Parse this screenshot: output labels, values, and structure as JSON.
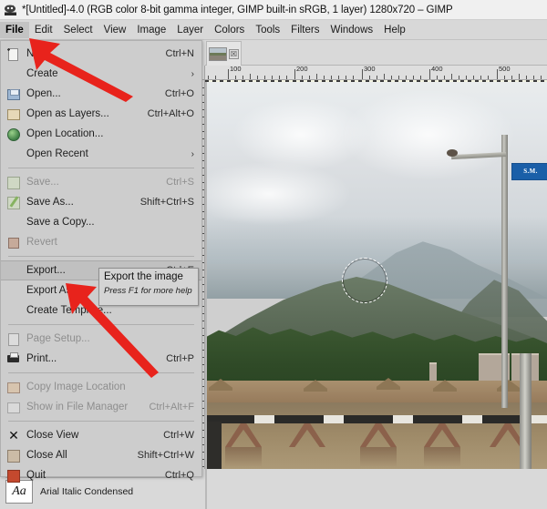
{
  "window": {
    "title": "*[Untitled]-4.0 (RGB color 8-bit gamma integer, GIMP built-in sRGB, 1 layer) 1280x720 – GIMP",
    "app_icon": "gimp-wilber-icon"
  },
  "menubar": {
    "items": [
      {
        "label": "File",
        "active": true
      },
      {
        "label": "Edit",
        "active": false
      },
      {
        "label": "Select",
        "active": false
      },
      {
        "label": "View",
        "active": false
      },
      {
        "label": "Image",
        "active": false
      },
      {
        "label": "Layer",
        "active": false
      },
      {
        "label": "Colors",
        "active": false
      },
      {
        "label": "Tools",
        "active": false
      },
      {
        "label": "Filters",
        "active": false
      },
      {
        "label": "Windows",
        "active": false
      },
      {
        "label": "Help",
        "active": false
      }
    ]
  },
  "file_menu": {
    "items": [
      {
        "label": "New...",
        "accel": "Ctrl+N",
        "icon": "new-file-icon",
        "disabled": false,
        "submenu": false,
        "selected": false
      },
      {
        "label": "Create",
        "accel": "",
        "icon": "",
        "disabled": false,
        "submenu": true,
        "selected": false
      },
      {
        "label": "Open...",
        "accel": "Ctrl+O",
        "icon": "open-file-icon",
        "disabled": false,
        "submenu": false,
        "selected": false
      },
      {
        "label": "Open as Layers...",
        "accel": "Ctrl+Alt+O",
        "icon": "open-as-layers-icon",
        "disabled": false,
        "submenu": false,
        "selected": false
      },
      {
        "label": "Open Location...",
        "accel": "",
        "icon": "globe-icon",
        "disabled": false,
        "submenu": false,
        "selected": false
      },
      {
        "label": "Open Recent",
        "accel": "",
        "icon": "",
        "disabled": false,
        "submenu": true,
        "selected": false
      },
      {
        "separator": true
      },
      {
        "label": "Save...",
        "accel": "Ctrl+S",
        "icon": "save-icon",
        "disabled": true,
        "submenu": false,
        "selected": false
      },
      {
        "label": "Save As...",
        "accel": "Shift+Ctrl+S",
        "icon": "save-as-icon",
        "disabled": false,
        "submenu": false,
        "selected": false
      },
      {
        "label": "Save a Copy...",
        "accel": "",
        "icon": "",
        "disabled": false,
        "submenu": false,
        "selected": false
      },
      {
        "label": "Revert",
        "accel": "",
        "icon": "revert-icon",
        "disabled": true,
        "submenu": false,
        "selected": false
      },
      {
        "separator": true
      },
      {
        "label": "Export...",
        "accel": "Ctrl+E",
        "icon": "",
        "disabled": false,
        "submenu": false,
        "selected": true
      },
      {
        "label": "Export As...",
        "accel": "",
        "icon": "",
        "disabled": false,
        "submenu": false,
        "selected": false
      },
      {
        "label": "Create Template...",
        "accel": "",
        "icon": "",
        "disabled": false,
        "submenu": false,
        "selected": false
      },
      {
        "separator": true
      },
      {
        "label": "Page Setup...",
        "accel": "",
        "icon": "page-setup-icon",
        "disabled": true,
        "submenu": false,
        "selected": false
      },
      {
        "label": "Print...",
        "accel": "Ctrl+P",
        "icon": "print-icon",
        "disabled": false,
        "submenu": false,
        "selected": false
      },
      {
        "separator": true
      },
      {
        "label": "Copy Image Location",
        "accel": "",
        "icon": "copy-location-icon",
        "disabled": true,
        "submenu": false,
        "selected": false
      },
      {
        "label": "Show in File Manager",
        "accel": "Ctrl+Alt+F",
        "icon": "file-manager-icon",
        "disabled": true,
        "submenu": false,
        "selected": false
      },
      {
        "separator": true
      },
      {
        "label": "Close View",
        "accel": "Ctrl+W",
        "icon": "close-x-icon",
        "disabled": false,
        "submenu": false,
        "selected": false
      },
      {
        "label": "Close All",
        "accel": "Shift+Ctrl+W",
        "icon": "close-all-icon",
        "disabled": false,
        "submenu": false,
        "selected": false
      },
      {
        "label": "Quit",
        "accel": "Ctrl+Q",
        "icon": "quit-icon",
        "disabled": false,
        "submenu": false,
        "selected": false
      }
    ]
  },
  "tooltip": {
    "title": "Export the image",
    "hint": "Press F1 for more help"
  },
  "image_tab": {
    "thumbnail": "image-thumbnail",
    "close_label": "☒"
  },
  "ruler": {
    "labels": [
      "100",
      "200",
      "300",
      "400",
      "500"
    ]
  },
  "canvas": {
    "sign_text": "S.M.",
    "selection": "elliptical-selection"
  },
  "font_row": {
    "preview": "Aa",
    "name": "Arial Italic Condensed"
  },
  "annotations": {
    "arrow_color": "#e8231c",
    "arrows": [
      {
        "name": "arrow-to-file-menu"
      },
      {
        "name": "arrow-to-export-as"
      }
    ]
  }
}
